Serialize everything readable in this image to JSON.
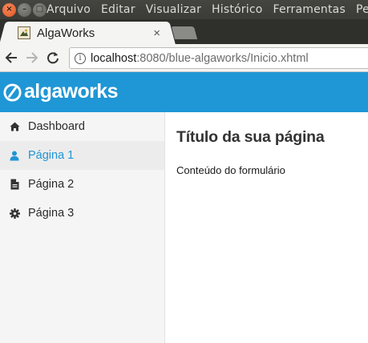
{
  "window": {
    "menu": [
      "Arquivo",
      "Editar",
      "Visualizar",
      "Histórico",
      "Ferramentas",
      "Pes"
    ]
  },
  "browser": {
    "tab_title": "AlgaWorks",
    "tab_close": "×",
    "url_host": "localhost",
    "url_rest": ":8080/blue-algaworks/Inicio.xhtml"
  },
  "app": {
    "logo_text": "algaworks",
    "brand_color": "#1f96d5"
  },
  "sidebar": {
    "items": [
      {
        "label": "Dashboard",
        "icon": "home-icon",
        "active": false
      },
      {
        "label": "Página 1",
        "icon": "user-icon",
        "active": true
      },
      {
        "label": "Página 2",
        "icon": "file-icon",
        "active": false
      },
      {
        "label": "Página 3",
        "icon": "gear-icon",
        "active": false
      }
    ]
  },
  "content": {
    "title": "Título da sua página",
    "body": "Conteúdo do formulário"
  }
}
